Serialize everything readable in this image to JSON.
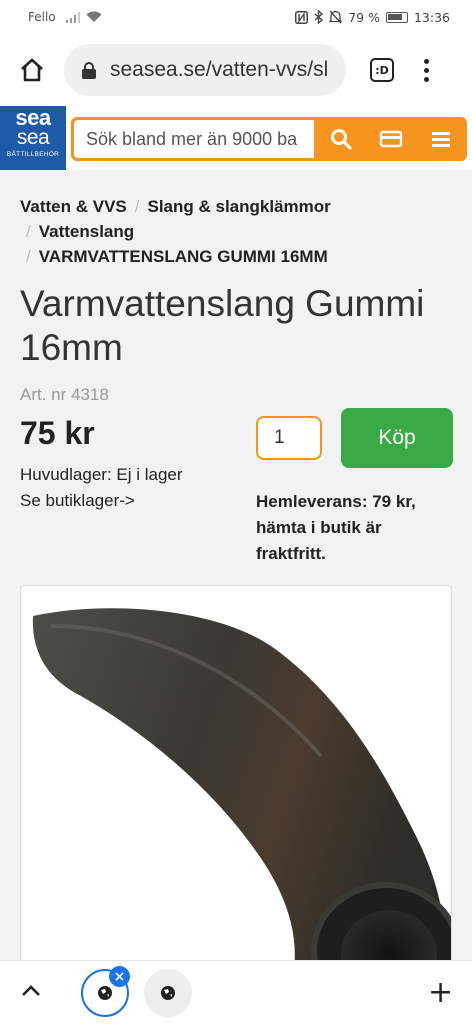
{
  "status_bar": {
    "carrier": "Fello",
    "battery": "79 %",
    "time": "13:36"
  },
  "browser": {
    "url": "seasea.se/vatten-vvs/sl",
    "tabs_label": ":D"
  },
  "site": {
    "logo_line1": "sea",
    "logo_line2": "sea",
    "logo_tagline": "BÅTTILLBEHÖR",
    "search_placeholder": "Sök bland mer än 9000 ba",
    "accent_color": "#f7941d",
    "brand_color": "#1e5aa8"
  },
  "breadcrumbs": [
    "Vatten & VVS",
    "Slang & slangklämmor",
    "Vattenslang",
    "VARMVATTENSLANG GUMMI 16MM"
  ],
  "product": {
    "title": "Varmvattenslang Gummi 16mm",
    "art_nr": "Art. nr 4318",
    "price": "75 kr",
    "stock_status": "Huvudlager: Ej i lager",
    "store_link": "Se butiklager->",
    "quantity": "1",
    "buy_label": "Köp",
    "buy_color": "#3aaa47",
    "delivery_note": "Hemleverans: 79 kr, hämta i butik är fraktfritt."
  },
  "bottom_bar": {
    "close_tab": "×",
    "new_tab": "+"
  }
}
